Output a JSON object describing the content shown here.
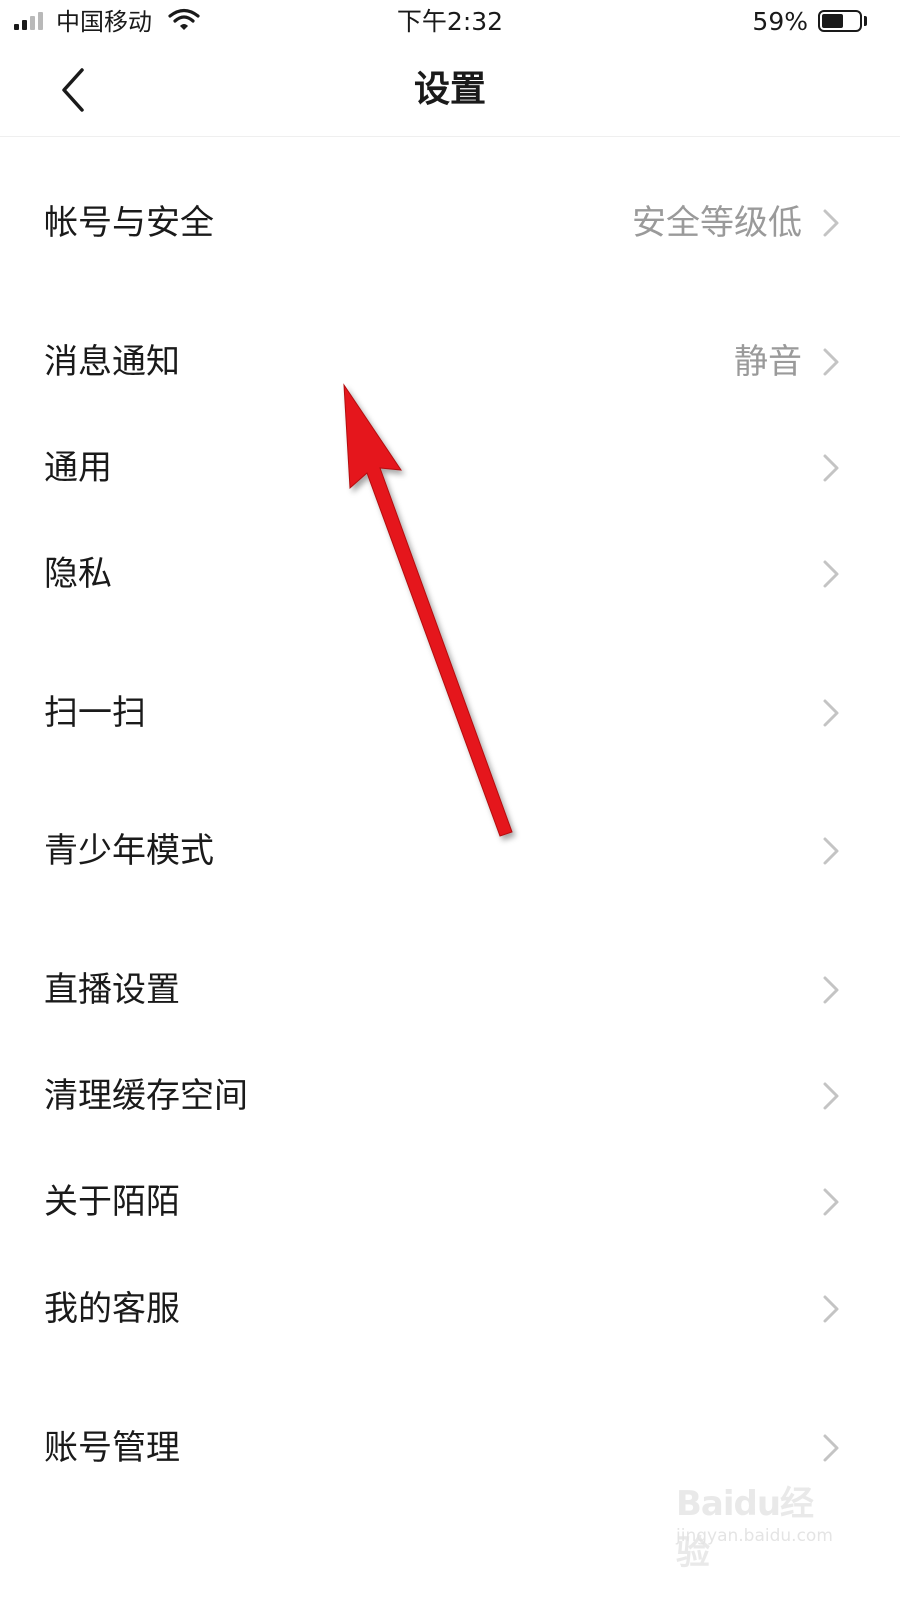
{
  "status_bar": {
    "carrier": "中国移动",
    "time": "下午2:32",
    "battery_percent_text": "59%",
    "battery_level": 0.59,
    "signal_bars_filled": 2,
    "signal_bars_total": 4
  },
  "header": {
    "title": "设置"
  },
  "settings": {
    "items": [
      {
        "label": "帐号与安全",
        "value": "安全等级低"
      },
      {
        "label": "消息通知",
        "value": "静音"
      },
      {
        "label": "通用",
        "value": ""
      },
      {
        "label": "隐私",
        "value": ""
      },
      {
        "label": "扫一扫",
        "value": ""
      },
      {
        "label": "青少年模式",
        "value": ""
      },
      {
        "label": "直播设置",
        "value": ""
      },
      {
        "label": "清理缓存空间",
        "value": ""
      },
      {
        "label": "关于陌陌",
        "value": ""
      },
      {
        "label": "我的客服",
        "value": ""
      },
      {
        "label": "账号管理",
        "value": ""
      }
    ]
  },
  "watermark": {
    "brand": "Baidu经验",
    "url": "jingyan.baidu.com"
  },
  "colors": {
    "text_primary": "#1a1a1a",
    "text_secondary": "#9a9a9a",
    "chevron": "#c4c4c4",
    "annotation_arrow": "#e5161b"
  },
  "icons": {
    "back": "chevron-left-icon",
    "row_arrow": "chevron-right-icon",
    "wifi": "wifi-icon",
    "signal": "signal-strength-icon",
    "battery": "battery-icon"
  }
}
